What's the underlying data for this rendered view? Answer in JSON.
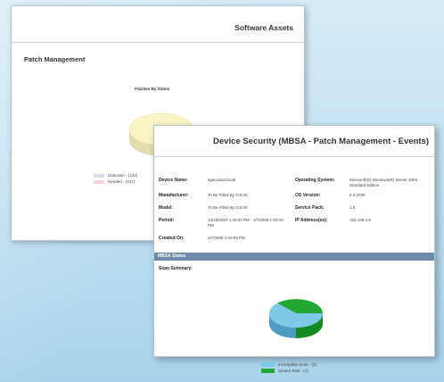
{
  "back_sheet": {
    "title": "Software Assets",
    "section": "Patch Management",
    "chart_title": "Patches By Status",
    "legend": [
      {
        "label": "Unknown - (133)",
        "color": "#dcd8ee"
      },
      {
        "label": "Needed - (447)",
        "color": "#f6d3d8"
      }
    ]
  },
  "front_sheet": {
    "title": "Device Security (MBSA - Patch Management - Events)",
    "fields_left": [
      {
        "label": "Device Name:",
        "value": "tigercubs3.local"
      },
      {
        "label": "Manufacturer:",
        "value": "To Be Filled By O.E.M."
      },
      {
        "label": "Model:",
        "value": "To Be Filled By O.E.M."
      },
      {
        "label": "Period:",
        "value": "12/19/2007 1:20:00 PM - 1/7/2008 1:20:00 PM"
      },
      {
        "label": "Created On:",
        "value": "1/7/2008 1:20:09 PM"
      }
    ],
    "fields_right": [
      {
        "label": "Operating System:",
        "value": "Microsoft(R) Windows(R) Server 2003, Standard Edition"
      },
      {
        "label": "OS Version:",
        "value": "5.2.3790"
      },
      {
        "label": "Service Pack:",
        "value": "1.0"
      },
      {
        "label": "IP Address(es):",
        "value": "192.168.2.6"
      }
    ],
    "status_bar": "MBSA Status",
    "scan_summary": "Scan Summary:",
    "legend": [
      {
        "label": "Incomplete Scan - (1)",
        "color": "#7ec8e8"
      },
      {
        "label": "Severe Risk - (1)",
        "color": "#22a832"
      }
    ]
  },
  "chart_data": [
    {
      "type": "pie",
      "title": "Patches By Status",
      "categories": [
        "Unknown",
        "Needed"
      ],
      "values": [
        133,
        447
      ],
      "colors": [
        "#dcd8ee",
        "#f6d3d8"
      ]
    },
    {
      "type": "pie",
      "title": "",
      "categories": [
        "Incomplete Scan",
        "Severe Risk"
      ],
      "values": [
        1,
        1
      ],
      "colors": [
        "#7ec8e8",
        "#22a832"
      ]
    }
  ]
}
